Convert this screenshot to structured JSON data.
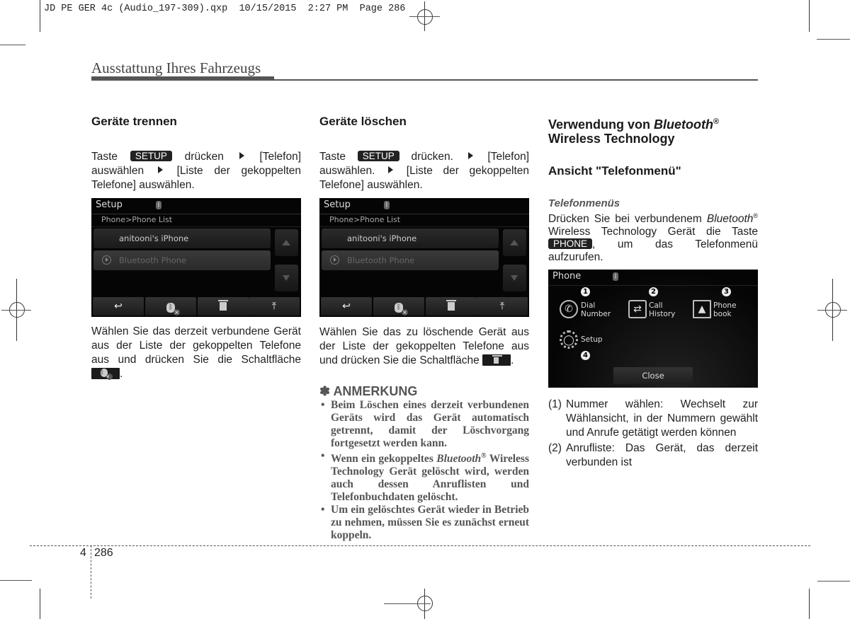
{
  "slug": {
    "file": "JD PE GER 4c (Audio_197-309).qxp",
    "date": "10/15/2015",
    "time": "2:27 PM",
    "page_label": "Page 286"
  },
  "running_head": "Ausstattung Ihres Fahrzeugs",
  "col1": {
    "heading": "Geräte trennen",
    "instr": {
      "pre": "Taste",
      "key": "SETUP",
      "mid1": "drücken",
      "mid2": "[Telefon] auswählen",
      "mid3": "[Liste der gekoppelten Telefone] auswählen."
    },
    "screen": {
      "title": "Setup",
      "bt_icon": "bluetooth-icon",
      "breadcrumb": "Phone>Phone List",
      "items": [
        {
          "label": "anitooni's iPhone",
          "state": "connected"
        },
        {
          "label": "Bluetooth Phone",
          "state": "inactive"
        }
      ],
      "toolbar": [
        "back-icon",
        "bluetooth-disconnect-icon",
        "trash-icon",
        "move-top-icon"
      ]
    },
    "body": {
      "text": "Wählen Sie das derzeit verbundene Gerät aus der Liste der gekoppelten Telefone aus und drücken Sie die Schaltfläche",
      "icon": "bluetooth-disconnect-icon",
      "end": "."
    }
  },
  "col2": {
    "heading": "Geräte löschen",
    "instr": {
      "pre": "Taste",
      "key": "SETUP",
      "mid1": "drücken.",
      "mid2": "[Telefon] auswählen.",
      "mid3": "[Liste der gekoppelten Telefone] auswählen."
    },
    "screen": {
      "title": "Setup",
      "bt_icon": "bluetooth-icon",
      "breadcrumb": "Phone>Phone List",
      "items": [
        {
          "label": "anitooni's iPhone",
          "state": "connected"
        },
        {
          "label": "Bluetooth Phone",
          "state": "inactive"
        }
      ],
      "toolbar": [
        "back-icon",
        "bluetooth-disconnect-icon",
        "trash-icon",
        "move-top-icon"
      ]
    },
    "body": {
      "text": "Wählen Sie das zu löschende Gerät aus der Liste der gekoppelten Telefone aus und drücken Sie die Schaltfläche",
      "icon": "trash-icon",
      "end": "."
    },
    "note": {
      "symbol": "✽",
      "title": "ANMERKUNG",
      "items": [
        "Beim Löschen eines derzeit verbundenen Geräts wird das Gerät automatisch getrennt, damit der Löschvorgang fortgesetzt werden kann.",
        {
          "pre": "Wenn ein gekoppeltes",
          "italic": "Bluetooth",
          "reg": "®",
          "post": "Wireless Technology Gerät gelöscht wird, werden auch dessen Anruflisten und Telefonbuchdaten gelöscht."
        },
        "Um ein gelöschtes Gerät wieder in Betrieb zu nehmen, müssen Sie es zunächst erneut koppeln."
      ]
    }
  },
  "col3": {
    "heading": {
      "pre": "Verwendung von",
      "italic": "Bluetooth",
      "reg": "®",
      "line2": "Wireless Technology"
    },
    "subheading": "Ansicht \"Telefonmenü\"",
    "sub2": "Telefonmenüs",
    "body": {
      "p1": "Drücken Sie bei verbundenem",
      "italic": "Bluetooth",
      "reg": "®",
      "p2": "Wireless Technology Gerät die Taste",
      "key": "PHONE",
      "p3": ", um das Telefonmenü aufzurufen."
    },
    "screen": {
      "title": "Phone",
      "bt_icon": "bluetooth-icon",
      "items": [
        {
          "num": "1",
          "icon": "phone-handset-icon",
          "line1": "Dial",
          "line2": "Number"
        },
        {
          "num": "2",
          "icon": "call-history-icon",
          "line1": "Call",
          "line2": "History"
        },
        {
          "num": "3",
          "icon": "phonebook-icon",
          "line1": "Phone",
          "line2": "book"
        },
        {
          "num": "4",
          "icon": "gear-icon",
          "line1": "Setup",
          "line2": ""
        }
      ],
      "close": "Close"
    },
    "list": [
      {
        "n": "(1)",
        "text": "Nummer wählen: Wechselt zur Wählansicht, in der Nummern gewählt und Anrufe getätigt werden können"
      },
      {
        "n": "(2)",
        "text": "Anrufliste: Das Gerät, das derzeit verbunden ist"
      }
    ]
  },
  "footer": {
    "chapter": "4",
    "page": "286"
  }
}
